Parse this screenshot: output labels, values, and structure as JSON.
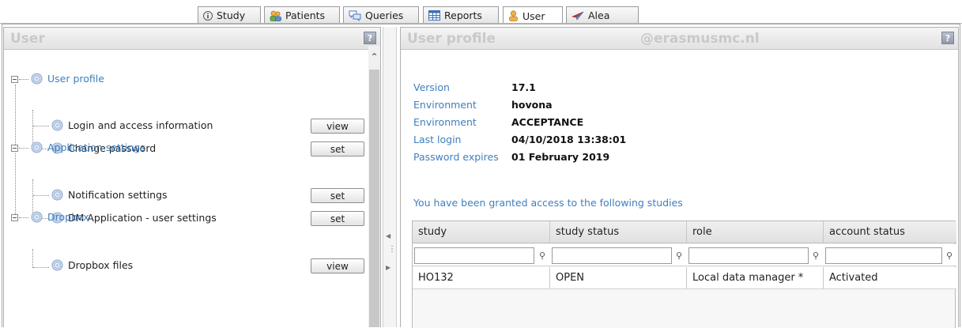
{
  "tabs": [
    {
      "label": "Study",
      "icon": "info-icon"
    },
    {
      "label": "Patients",
      "icon": "patients-icon"
    },
    {
      "label": "Queries",
      "icon": "queries-icon"
    },
    {
      "label": "Reports",
      "icon": "reports-icon"
    },
    {
      "label": "User",
      "icon": "user-icon",
      "active": true
    },
    {
      "label": "Alea",
      "icon": "alea-icon"
    }
  ],
  "left_panel": {
    "title": "User",
    "help": "?",
    "tree": {
      "user_profile": {
        "label": "User profile",
        "children": [
          {
            "label": "Login and access information",
            "button": "view"
          },
          {
            "label": "Change password",
            "button": "set"
          }
        ]
      },
      "application_settings": {
        "label": "Application settings",
        "children": [
          {
            "label": "Notification settings",
            "button": "set"
          },
          {
            "label": "DM Application - user settings",
            "button": "set"
          }
        ]
      },
      "dropbox": {
        "label": "Dropbox",
        "children": [
          {
            "label": "Dropbox files",
            "button": "view"
          }
        ]
      }
    }
  },
  "right_panel": {
    "title": "User profile",
    "domain": "@erasmusmc.nl",
    "help": "?",
    "info": [
      {
        "key": "Version",
        "value": "17.1"
      },
      {
        "key": "Environment",
        "value": "hovona"
      },
      {
        "key": "Environment",
        "value": "ACCEPTANCE"
      },
      {
        "key": "Last login",
        "value": "04/10/2018 13:38:01"
      },
      {
        "key": "Password expires",
        "value": "01 February 2019"
      }
    ],
    "granted_text": "You have been granted access to the following studies",
    "table": {
      "columns": [
        "study",
        "study status",
        "role",
        "account status"
      ],
      "filter_placeholder": "",
      "rows": [
        [
          "HO132",
          "OPEN",
          "Local data manager *",
          "Activated"
        ]
      ]
    }
  },
  "colors": {
    "link": "#3f7fbf",
    "header_text": "#c9c9c9"
  }
}
